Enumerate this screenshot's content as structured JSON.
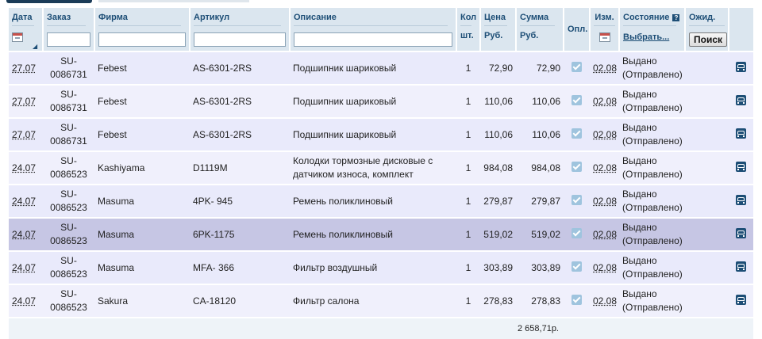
{
  "header": {
    "date": "Дата",
    "order": "Заказ",
    "firm": "Фирма",
    "article": "Артикул",
    "description": "Описание",
    "qty": "Кол",
    "qty_unit": "шт.",
    "price": "Цена",
    "price_unit": "Руб.",
    "sum": "Сумма",
    "sum_unit": "Руб.",
    "paid": "Опл.",
    "changed": "Изм.",
    "state": "Состояние",
    "state_help": "?",
    "state_choose": "Выбрать...",
    "expected": "Ожид.",
    "search_button": "Поиск"
  },
  "filters": {
    "order": "",
    "firm": "",
    "article": "",
    "description": ""
  },
  "rows": [
    {
      "date": "27.07",
      "order1": "SU-",
      "order2": "0086731",
      "firm": "Febest",
      "article": "AS-6301-2RS",
      "desc1": "Подшипник шариковый",
      "desc2": "",
      "qty": "1",
      "price": "72,90",
      "sum": "72,90",
      "changed": "02.08",
      "status1": "Выдано",
      "status2": "(Отправлено)"
    },
    {
      "date": "27.07",
      "order1": "SU-",
      "order2": "0086731",
      "firm": "Febest",
      "article": "AS-6301-2RS",
      "desc1": "Подшипник шариковый",
      "desc2": "",
      "qty": "1",
      "price": "110,06",
      "sum": "110,06",
      "changed": "02.08",
      "status1": "Выдано",
      "status2": "(Отправлено)"
    },
    {
      "date": "27.07",
      "order1": "SU-",
      "order2": "0086731",
      "firm": "Febest",
      "article": "AS-6301-2RS",
      "desc1": "Подшипник шариковый",
      "desc2": "",
      "qty": "1",
      "price": "110,06",
      "sum": "110,06",
      "changed": "02.08",
      "status1": "Выдано",
      "status2": "(Отправлено)"
    },
    {
      "date": "24.07",
      "order1": "SU-",
      "order2": "0086523",
      "firm": "Kashiyama",
      "article": "D1119M",
      "desc1": "Колодки тормозные дисковые с",
      "desc2": "датчиком износа, комплект",
      "qty": "1",
      "price": "984,08",
      "sum": "984,08",
      "changed": "02.08",
      "status1": "Выдано",
      "status2": "(Отправлено)"
    },
    {
      "date": "24.07",
      "order1": "SU-",
      "order2": "0086523",
      "firm": "Masuma",
      "article": "4PK- 945",
      "desc1": "Ремень поликлиновый",
      "desc2": "",
      "qty": "1",
      "price": "279,87",
      "sum": "279,87",
      "changed": "02.08",
      "status1": "Выдано",
      "status2": "(Отправлено)"
    },
    {
      "date": "24.07",
      "order1": "SU-",
      "order2": "0086523",
      "firm": "Masuma",
      "article": "6PK-1175",
      "desc1": "Ремень поликлиновый",
      "desc2": "",
      "qty": "1",
      "price": "519,02",
      "sum": "519,02",
      "changed": "02.08",
      "status1": "Выдано",
      "status2": "(Отправлено)"
    },
    {
      "date": "24.07",
      "order1": "SU-",
      "order2": "0086523",
      "firm": "Masuma",
      "article": "MFA- 366",
      "desc1": "Фильтр воздушный",
      "desc2": "",
      "qty": "1",
      "price": "303,89",
      "sum": "303,89",
      "changed": "02.08",
      "status1": "Выдано",
      "status2": "(Отправлено)"
    },
    {
      "date": "24.07",
      "order1": "SU-",
      "order2": "0086523",
      "firm": "Sakura",
      "article": "CA-18120",
      "desc1": "Фильтр салона",
      "desc2": "",
      "qty": "1",
      "price": "278,83",
      "sum": "278,83",
      "changed": "02.08",
      "status1": "Выдано",
      "status2": "(Отправлено)"
    }
  ],
  "footer": {
    "total": "2 658,71р."
  },
  "icons": {
    "calendar": "calendar-icon",
    "paid_check": "checkbox-checked-icon",
    "delivery": "car-icon",
    "help": "help-icon",
    "sort": "sort-arrow-icon"
  }
}
